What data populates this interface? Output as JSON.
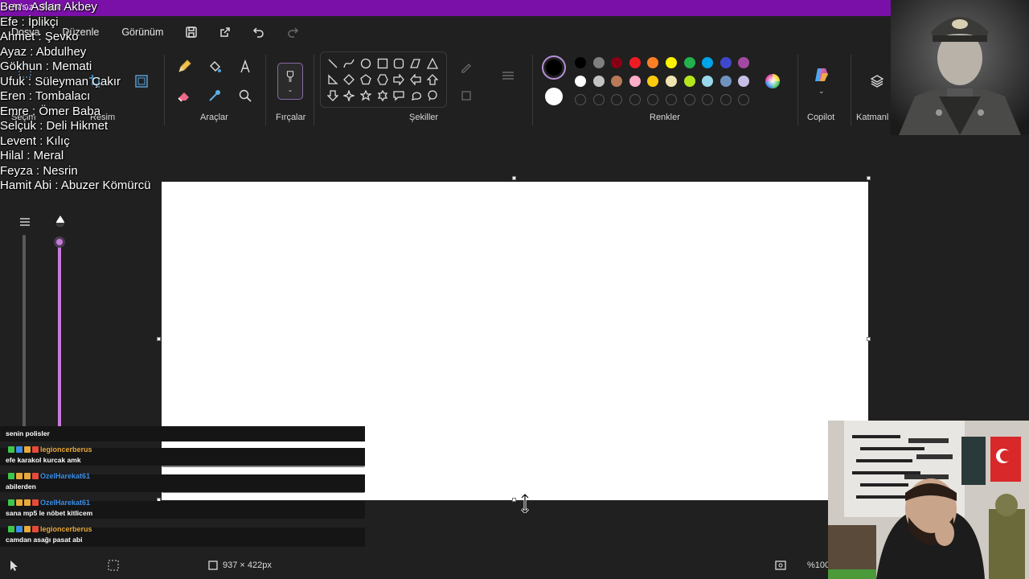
{
  "window": {
    "title": "Adsız - Paint"
  },
  "menu": {
    "items": [
      "Dosya",
      "Düzenle",
      "Görünüm"
    ]
  },
  "ribbon": {
    "groups": {
      "selection": "Seçim",
      "image": "Resim",
      "tools": "Araçlar",
      "brushes": "Fırçalar",
      "shapes": "Şekiller",
      "colors": "Renkler",
      "copilot": "Copilot",
      "layers": "Katmanl"
    },
    "palette_row1": [
      "#000000",
      "#7f7f7f",
      "#880015",
      "#ed1c24",
      "#ff7f27",
      "#fff200",
      "#22b14c",
      "#00a2e8",
      "#3f48cc",
      "#a349a4"
    ],
    "palette_row2": [
      "#ffffff",
      "#c3c3c3",
      "#b97a57",
      "#ffaec9",
      "#ffc90e",
      "#efe4b0",
      "#b5e61d",
      "#99d9ea",
      "#7092be",
      "#c8bfe7"
    ],
    "current_color_1": "#000000",
    "current_color_2": "#ffffff"
  },
  "overlay_names": [
    "Ben : Aslan Akbey",
    "Efe : İplikçi",
    "Ahmet : Şevko",
    "Ayaz : Abdulhey",
    "Gökhun : Memati",
    "Ufuk : Süleyman Çakır",
    "Eren : Tombalacı",
    "Emre : Ömer Baba",
    "Selçuk : Deli Hikmet",
    "Levent : Kılıç",
    "Hilal : Meral",
    "Feyza : Nesrin",
    "Hamit Abi : Abuzer Kömürcü"
  ],
  "chat": [
    {
      "user": "",
      "message": "senin polisler",
      "color": ""
    },
    {
      "user": "legioncerberus",
      "message": "efe karakol kurcak amk",
      "color": "#e8a93a"
    },
    {
      "user": "OzelHarekat61",
      "message": "abilerden",
      "color": "#3a8ee8"
    },
    {
      "user": "OzelHarekat61",
      "message": "sana mp5 le nöbet kitlicem",
      "color": "#3a8ee8"
    },
    {
      "user": "legioncerberus",
      "message": "camdan asağı pasat abi",
      "color": "#e8a93a"
    }
  ],
  "status": {
    "canvas_size": "937 × 422px",
    "zoom": "%100"
  }
}
